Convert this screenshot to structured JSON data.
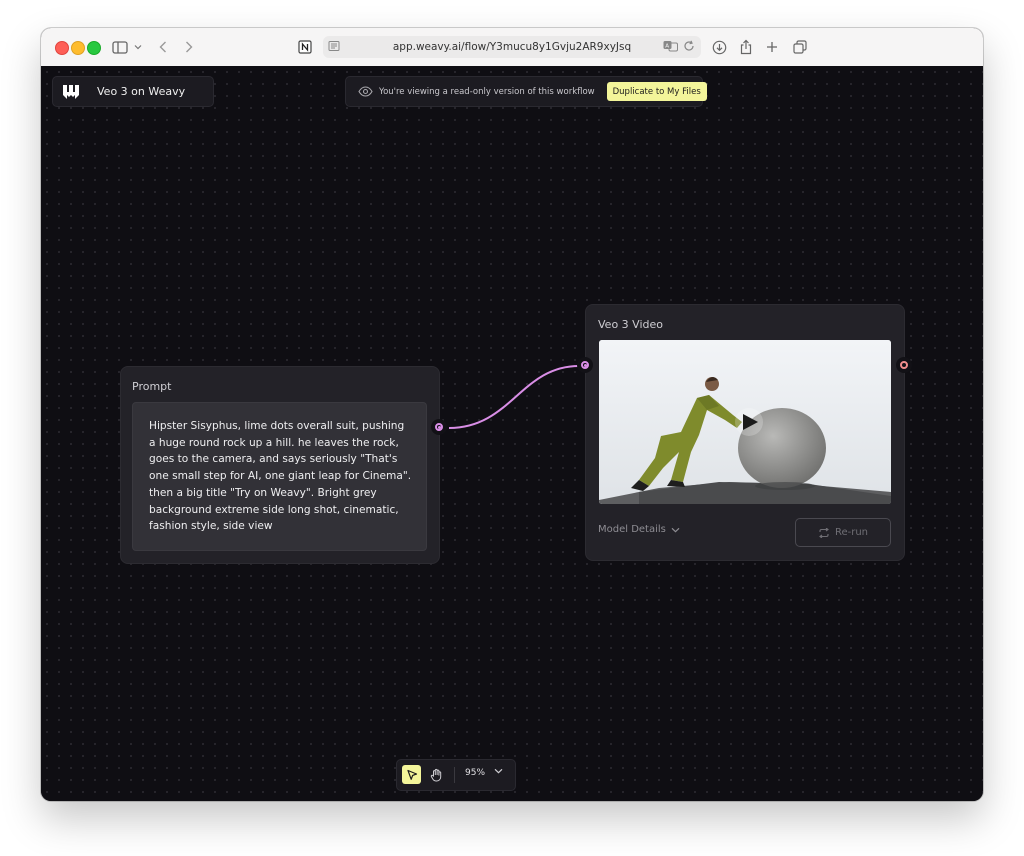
{
  "browser": {
    "url": "app.weavy.ai/flow/Y3mucu8y1Gvju2AR9xyJsq",
    "icons": [
      "sidebar-icon",
      "chevron-down-icon",
      "back-icon",
      "forward-icon",
      "notion-icon",
      "reader-icon",
      "translate-icon",
      "reload-icon",
      "download-icon",
      "share-icon",
      "new-tab-icon",
      "tabs-icon"
    ]
  },
  "app": {
    "workflow_title": "Veo 3 on Weavy",
    "readonly_notice": "You're viewing a read-only version of this workflow",
    "duplicate_label": "Duplicate to My Files",
    "accent_color": "#f3f59a",
    "connection_color": "#d98ee6"
  },
  "prompt_node": {
    "title": "Prompt",
    "text": "Hipster Sisyphus, lime dots overall suit, pushing a huge round rock up a hill. he leaves the rock, goes to the camera, and says seriously \"That's one small step for AI, one giant leap for Cinema\". then a big title \"Try on Weavy\". Bright grey background extreme side long shot, cinematic, fashion style, side view"
  },
  "video_node": {
    "title": "Veo 3 Video",
    "model_details_label": "Model Details",
    "rerun_label": "Re-run"
  },
  "bottom_toolbar": {
    "zoom": "95%"
  }
}
